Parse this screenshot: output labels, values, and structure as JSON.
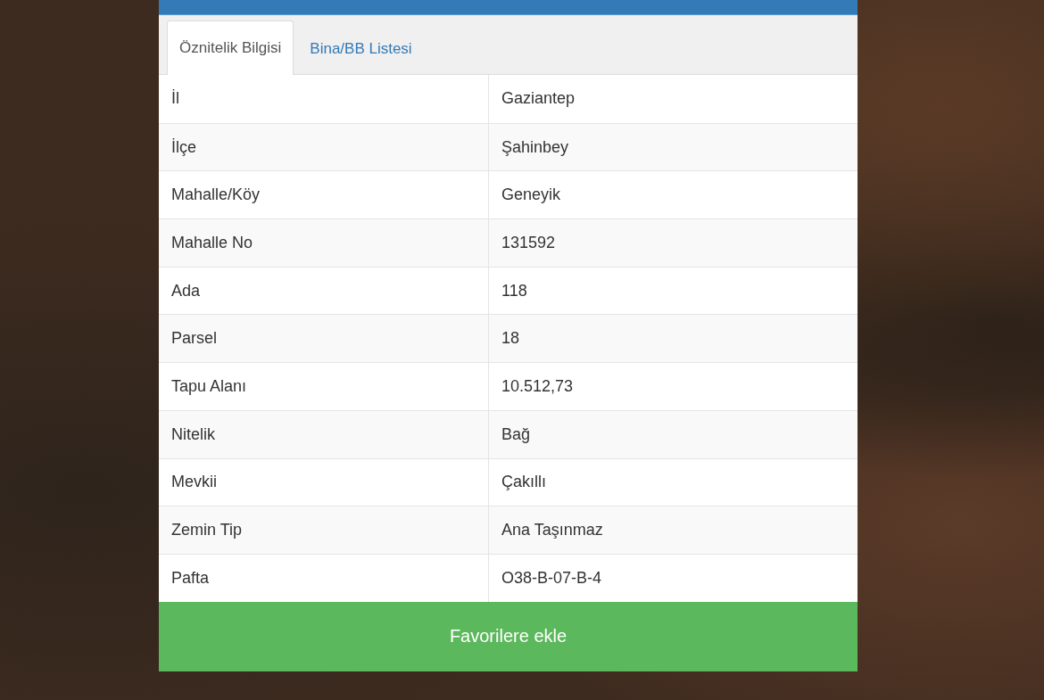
{
  "tabs": [
    {
      "label": "Öznitelik Bilgisi",
      "selected": true
    },
    {
      "label": "Bina/BB Listesi",
      "selected": false
    }
  ],
  "attributes": [
    {
      "label": "İl",
      "value": "Gaziantep"
    },
    {
      "label": "İlçe",
      "value": "Şahinbey"
    },
    {
      "label": "Mahalle/Köy",
      "value": "Geneyik"
    },
    {
      "label": "Mahalle No",
      "value": "131592"
    },
    {
      "label": "Ada",
      "value": "118"
    },
    {
      "label": "Parsel",
      "value": "18"
    },
    {
      "label": "Tapu Alanı",
      "value": "10.512,73"
    },
    {
      "label": "Nitelik",
      "value": "Bağ"
    },
    {
      "label": "Mevkii",
      "value": "Çakıllı"
    },
    {
      "label": "Zemin Tip",
      "value": "Ana Taşınmaz"
    },
    {
      "label": "Pafta",
      "value": "O38-B-07-B-4"
    }
  ],
  "button": {
    "label": "Favorilere ekle"
  }
}
